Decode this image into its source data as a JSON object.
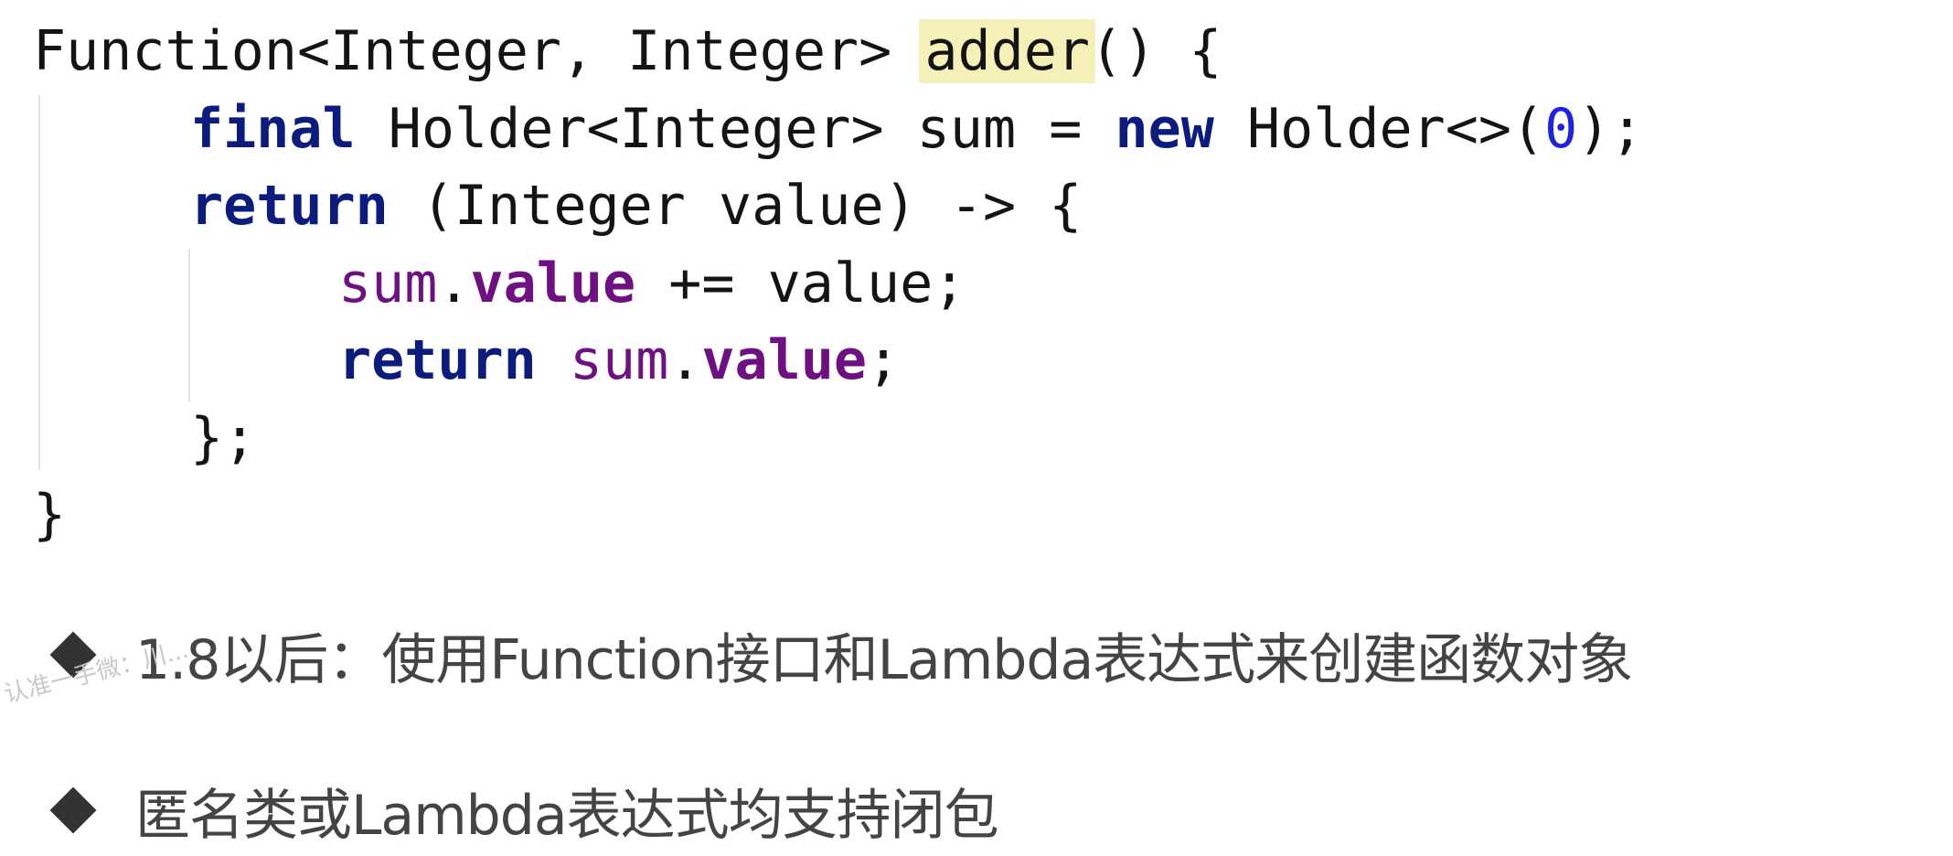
{
  "code": {
    "line1": {
      "type": "Function<Integer, Integer> ",
      "method": "adder",
      "rest": "() {"
    },
    "line2": {
      "kw_final": "final",
      "mid": " Holder<Integer> sum = ",
      "kw_new": "new",
      "holder": " Holder<>(",
      "num": "0",
      "end": ");"
    },
    "line3": {
      "kw_return": "return",
      "rest": " (Integer value) -> {"
    },
    "line4": {
      "sum": "sum",
      "dot": ".",
      "field": "value",
      "rest": " += value;"
    },
    "line5": {
      "kw_return": "return",
      "space": " ",
      "sum": "sum",
      "dot": ".",
      "field": "value",
      "end": ";"
    },
    "line6": "};",
    "line7": "}"
  },
  "bullets": [
    {
      "text": "1.8以后：使用Function接口和Lambda表达式来创建函数对象"
    },
    {
      "text": "匿名类或Lambda表达式均支持闭包"
    }
  ],
  "watermark": "认准一手微：川..."
}
